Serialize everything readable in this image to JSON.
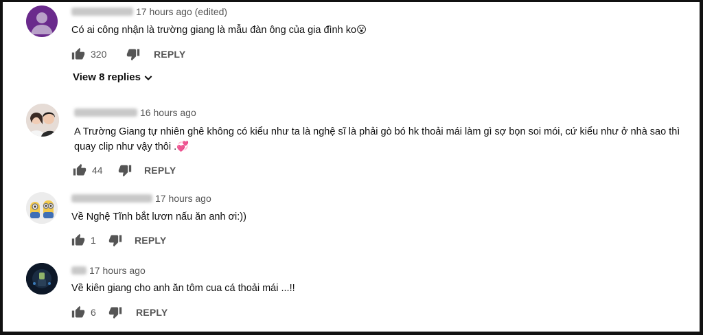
{
  "comments": [
    {
      "time": "17 hours ago (edited)",
      "text": "Có ai công nhận là trường giang là mẫu đàn ông của gia đình ko😮",
      "likes": "320",
      "reply_label": "REPLY",
      "view_replies": "View 8 replies"
    },
    {
      "time": "16 hours ago",
      "text": "A Trường Giang tự nhiên ghê không có kiểu như ta là nghệ sĩ là phải gò bó hk thoải mái làm gì sợ bọn soi mói, cứ kiểu như ở nhà sao thì quay clip như vậy thôi .💞",
      "likes": "44",
      "reply_label": "REPLY"
    },
    {
      "time": "17 hours ago",
      "text": "Về Nghệ Tĩnh bắt lươn nấu ăn anh ơi:))",
      "likes": "1",
      "reply_label": "REPLY"
    },
    {
      "time": "17 hours ago",
      "text": "Về kiên giang cho anh ăn tôm cua cá thoải mái ...!!",
      "likes": "6",
      "reply_label": "REPLY"
    }
  ],
  "colors": {
    "text": "#0f0f0f",
    "meta": "#606060",
    "avatar1": "#6a2a8c"
  },
  "icons": [
    "person-icon",
    "thumb-up-icon",
    "thumb-down-icon",
    "chevron-down-icon"
  ]
}
